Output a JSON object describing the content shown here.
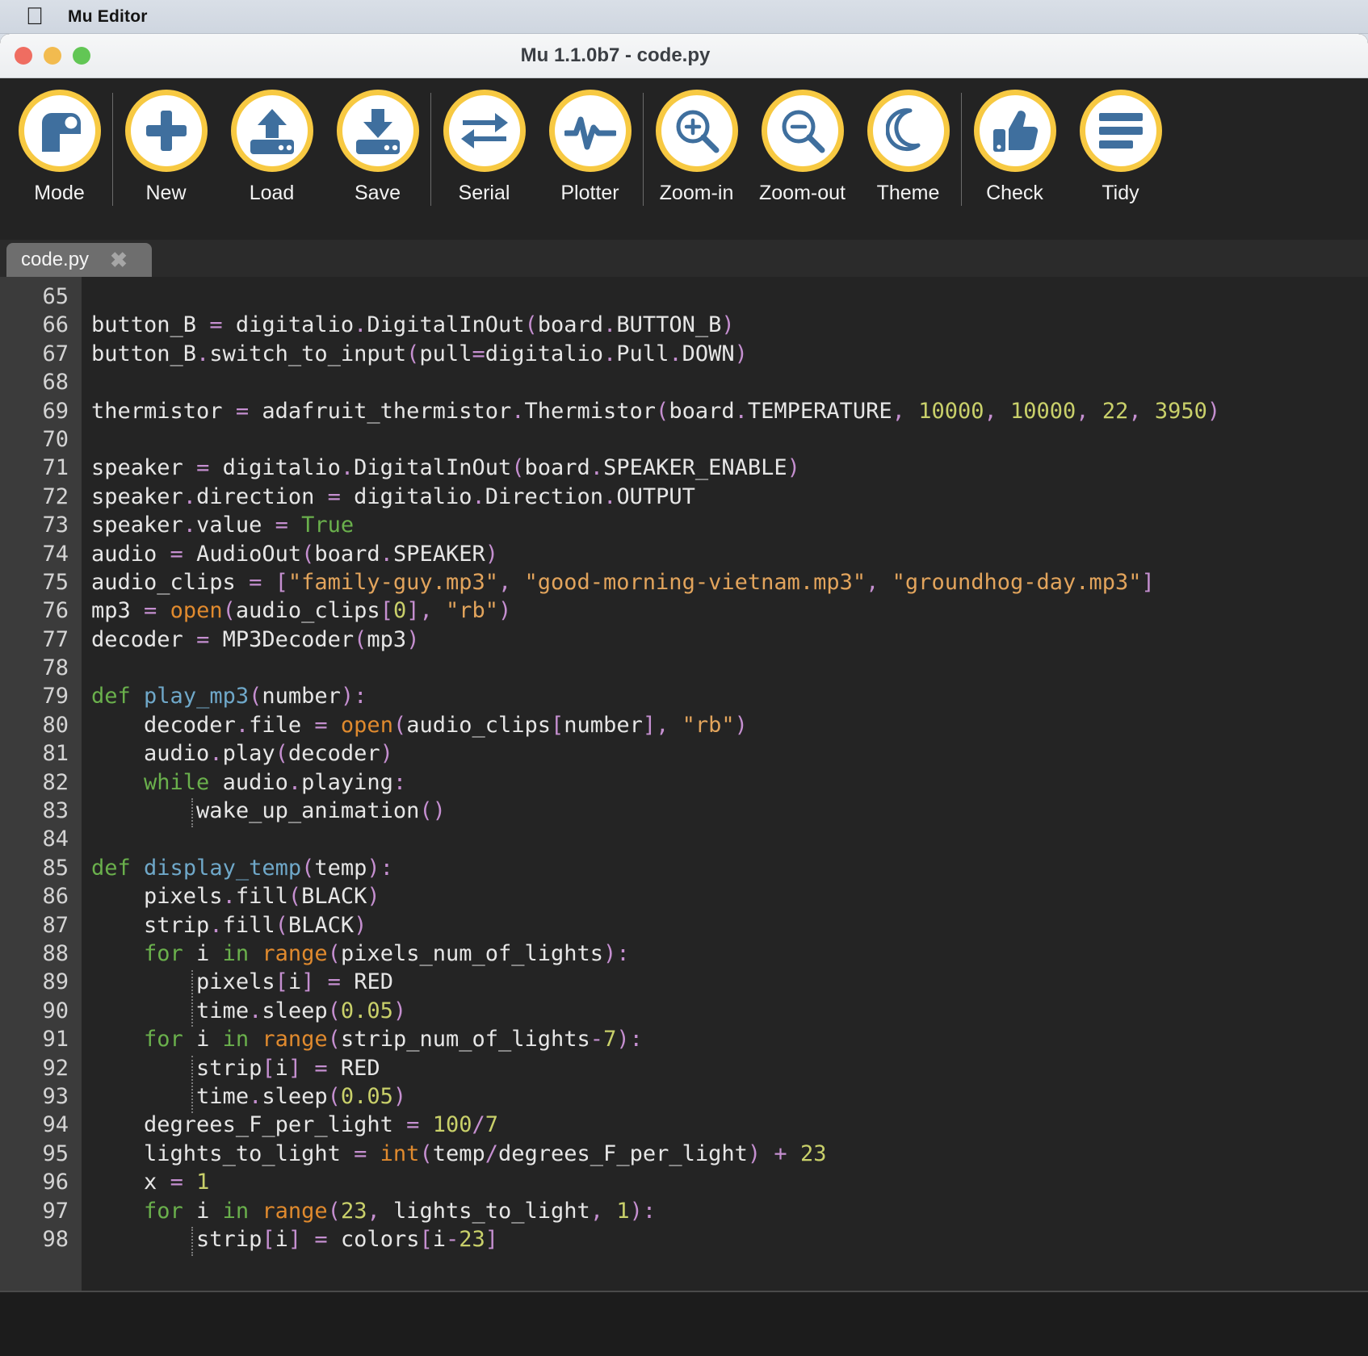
{
  "menubar": {
    "apple_icon": "apple-logo-icon",
    "app_name": "Mu Editor"
  },
  "window": {
    "title": "Mu 1.1.0b7 - code.py",
    "traffic_lights": [
      "close",
      "minimize",
      "zoom"
    ]
  },
  "toolbar": {
    "items": [
      {
        "label": "Mode",
        "icon": "mode-icon"
      },
      {
        "label": "New",
        "icon": "plus-icon"
      },
      {
        "label": "Load",
        "icon": "upload-icon"
      },
      {
        "label": "Save",
        "icon": "download-icon"
      },
      {
        "label": "Serial",
        "icon": "swap-arrows-icon"
      },
      {
        "label": "Plotter",
        "icon": "waveform-icon"
      },
      {
        "label": "Zoom-in",
        "icon": "magnifier-plus-icon"
      },
      {
        "label": "Zoom-out",
        "icon": "magnifier-minus-icon"
      },
      {
        "label": "Theme",
        "icon": "moon-icon"
      },
      {
        "label": "Check",
        "icon": "thumbs-up-icon"
      },
      {
        "label": "Tidy",
        "icon": "lines-icon"
      }
    ]
  },
  "tabs": [
    {
      "label": "code.py",
      "close": "✖"
    }
  ],
  "editor": {
    "first_line_number": 65,
    "line_numbers": [
      65,
      66,
      67,
      68,
      69,
      70,
      71,
      72,
      73,
      74,
      75,
      76,
      77,
      78,
      79,
      80,
      81,
      82,
      83,
      84,
      85,
      86,
      87,
      88,
      89,
      90,
      91,
      92,
      93,
      94,
      95,
      96,
      97,
      98
    ],
    "lines": [
      "",
      "button_B = digitalio.DigitalInOut(board.BUTTON_B)",
      "button_B.switch_to_input(pull=digitalio.Pull.DOWN)",
      "",
      "thermistor = adafruit_thermistor.Thermistor(board.TEMPERATURE, 10000, 10000, 22, 3950)",
      "",
      "speaker = digitalio.DigitalInOut(board.SPEAKER_ENABLE)",
      "speaker.direction = digitalio.Direction.OUTPUT",
      "speaker.value = True",
      "audio = AudioOut(board.SPEAKER)",
      "audio_clips = [\"family-guy.mp3\", \"good-morning-vietnam.mp3\", \"groundhog-day.mp3\"]",
      "mp3 = open(audio_clips[0], \"rb\")",
      "decoder = MP3Decoder(mp3)",
      "",
      "def play_mp3(number):",
      "    decoder.file = open(audio_clips[number], \"rb\")",
      "    audio.play(decoder)",
      "    while audio.playing:",
      "        wake_up_animation()",
      "",
      "def display_temp(temp):",
      "    pixels.fill(BLACK)",
      "    strip.fill(BLACK)",
      "    for i in range(pixels_num_of_lights):",
      "        pixels[i] = RED",
      "        time.sleep(0.05)",
      "    for i in range(strip_num_of_lights-7):",
      "        strip[i] = RED",
      "        time.sleep(0.05)",
      "    degrees_F_per_light = 100/7",
      "    lights_to_light = int(temp/degrees_F_per_light) + 23",
      "    x = 1",
      "    for i in range(23, lights_to_light, 1):",
      "        strip[i] = colors[i-23]"
    ]
  },
  "colors": {
    "accent_yellow": "#f7c942",
    "icon_blue": "#3f6f9e",
    "editor_bg": "#242424",
    "gutter_bg": "#3b3b3b",
    "toolbar_bg": "#232323",
    "keyword": "#6ab04c",
    "function": "#6fa8c9",
    "builtin": "#e08a2e",
    "number": "#c9d06a",
    "string": "#e2a45c",
    "operator": "#c58fd0",
    "plain": "#e6e6e6"
  }
}
